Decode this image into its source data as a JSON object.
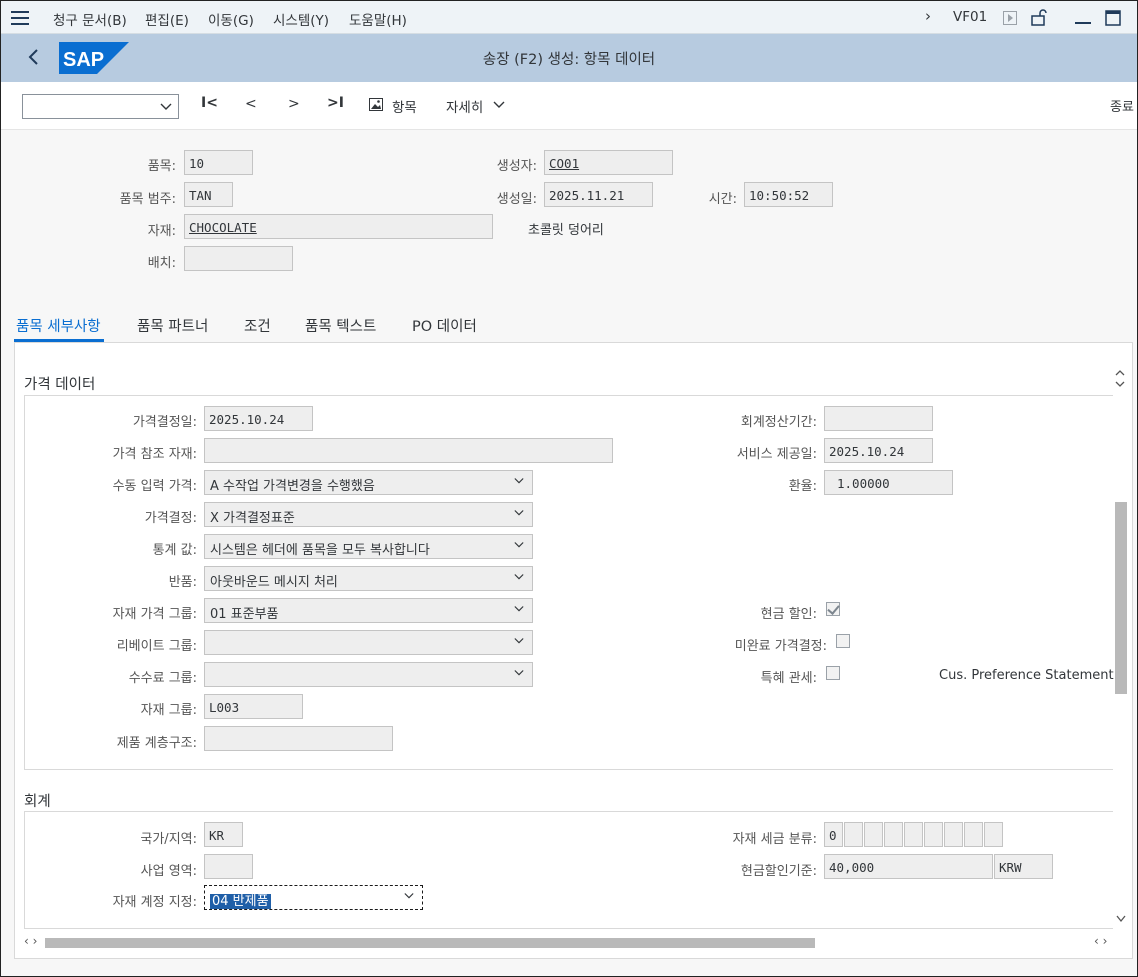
{
  "menu": {
    "items": [
      "청구 문서(B)",
      "편집(E)",
      "이동(G)",
      "시스템(Y)",
      "도움말(H)"
    ],
    "tcode": "VF01"
  },
  "titlebar": {
    "title": "송장 (F2) 생성: 항목 데이터"
  },
  "toolbar": {
    "item_label": "항목",
    "details_label": "자세히",
    "exit_label": "종료"
  },
  "header": {
    "item_label": "품목:",
    "item_value": "10",
    "category_label": "품목 범주:",
    "category_value": "TAN",
    "material_label": "자재:",
    "material_value": "CHOCOLATE",
    "material_desc": "초콜릿 덩어리",
    "batch_label": "배치:",
    "batch_value": "",
    "created_by_label": "생성자:",
    "created_by_value": "CO01",
    "created_on_label": "생성일:",
    "created_on_value": "2025.11.21",
    "time_label": "시간:",
    "time_value": "10:50:52"
  },
  "tabs": [
    "품목 세부사항",
    "품목 파트너",
    "조건",
    "품목 텍스트",
    "PO 데이터"
  ],
  "pricing": {
    "section_title": "가격 데이터",
    "pricing_date_label": "가격결정일:",
    "pricing_date_value": "2025.10.24",
    "ref_material_label": "가격 참조 자재:",
    "ref_material_value": "",
    "manual_price_label": "수동 입력 가격:",
    "manual_price_value": "A 수작업 가격변경을 수행했음",
    "pricing_label": "가격결정:",
    "pricing_value": "X 가격결정표준",
    "stat_value_label": "통계 값:",
    "stat_value_value": "시스템은 헤더에 품목을 모두 복사합니다",
    "returns_label": "반품:",
    "returns_value": "아웃바운드 메시지 처리",
    "mat_price_group_label": "자재 가격 그룹:",
    "mat_price_group_value": "01 표준부품",
    "rebate_group_label": "리베이트 그룹:",
    "rebate_group_value": "",
    "commission_group_label": "수수료 그룹:",
    "commission_group_value": "",
    "material_group_label": "자재 그룹:",
    "material_group_value": "L003",
    "prod_hierarchy_label": "제품 계층구조:",
    "prod_hierarchy_value": "",
    "settlement_period_label": "회계정산기간:",
    "settlement_period_value": "",
    "service_date_label": "서비스 제공일:",
    "service_date_value": "2025.10.24",
    "exchange_rate_label": "환율:",
    "exchange_rate_value": "1.00000",
    "cash_discount_label": "현금 할인:",
    "cash_discount_checked": true,
    "incomplete_label": "미완료 가격결정:",
    "incomplete_checked": false,
    "preference_label": "특혜 관세:",
    "preference_checked": false,
    "preference_statement": "Cus. Preference Statement"
  },
  "accounting": {
    "section_title": "회계",
    "country_label": "국가/지역:",
    "country_value": "KR",
    "business_area_label": "사업 영역:",
    "business_area_value": "",
    "acct_assign_label": "자재 계정 지정:",
    "acct_assign_value": "04 반제품",
    "tax_class_label": "자재 세금 분류:",
    "tax_class_value": "0",
    "cash_disc_base_label": "현금할인기준:",
    "cash_disc_base_value": "40,000",
    "currency": "KRW"
  }
}
